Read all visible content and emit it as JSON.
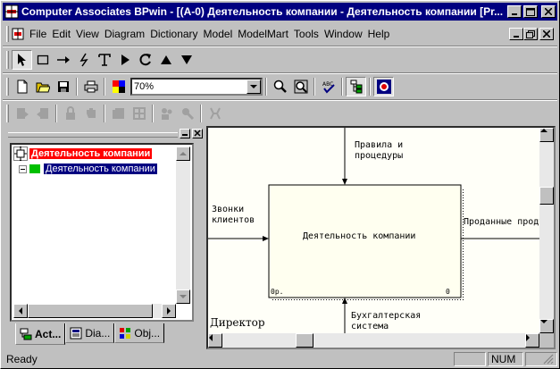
{
  "window": {
    "title": "Computer Associates BPwin - [(A-0) Деятельность компании - Деятельность компании  [Pr..."
  },
  "menu": {
    "items": [
      "File",
      "Edit",
      "View",
      "Diagram",
      "Dictionary",
      "Model",
      "ModelMart",
      "Tools",
      "Window",
      "Help"
    ]
  },
  "toolbar": {
    "zoom_value": "70%"
  },
  "tree": {
    "root_label": "Деятельность компании",
    "child_label": "Деятельность компании"
  },
  "tabs": [
    {
      "label": "Act..."
    },
    {
      "label": "Dia..."
    },
    {
      "label": "Obj..."
    }
  ],
  "diagram": {
    "box_title": "Деятельность компании",
    "box_corner_left": "0р.",
    "box_corner_right": "0",
    "control_label": "Правила и\nпроцедуры",
    "input_label": "Звонки\nклиентов",
    "output_label": "Проданные продукты",
    "mechanism_label": "Бухгалтерская\nсистема",
    "mechanism2_label": "Директор",
    "colors": {
      "canvas": "#fffff8",
      "box_fill": "#fffff0"
    }
  },
  "status": {
    "text": "Ready",
    "num": "NUM"
  },
  "icons": {
    "app": "bpwin-app-icon",
    "mdi": "bpwin-doc-icon"
  }
}
